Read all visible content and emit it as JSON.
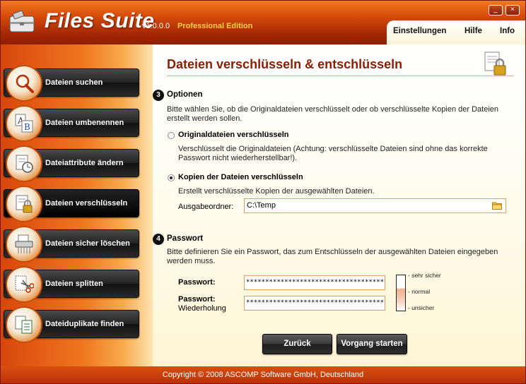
{
  "app": {
    "title": "Files Suite",
    "version": "v1.0.0.0",
    "edition": "Professional Edition"
  },
  "window_controls": {
    "minimize": "_",
    "close": "×"
  },
  "menu": {
    "items": [
      {
        "label": "Einstellungen"
      },
      {
        "label": "Hilfe"
      },
      {
        "label": "Info"
      }
    ]
  },
  "sidebar": {
    "items": [
      {
        "label": "Dateien suchen",
        "icon": "magnifier-icon",
        "active": false
      },
      {
        "label": "Dateien umbenennen",
        "icon": "rename-ab-icon",
        "active": false
      },
      {
        "label": "Dateiattribute ändern",
        "icon": "file-attribute-icon",
        "active": false
      },
      {
        "label": "Dateien verschlüsseln",
        "icon": "lock-document-icon",
        "active": true
      },
      {
        "label": "Dateien sicher löschen",
        "icon": "shredder-icon",
        "active": false
      },
      {
        "label": "Dateien splitten",
        "icon": "scissors-document-icon",
        "active": false
      },
      {
        "label": "Dateiduplikate finden",
        "icon": "duplicate-documents-icon",
        "active": false
      }
    ]
  },
  "main": {
    "title": "Dateien verschlüsseln & entschlüsseln",
    "options": {
      "step": "3",
      "title": "Optionen",
      "description": "Bitte wählen Sie, ob die Originaldateien verschlüsselt oder ob verschlüsselte Kopien der Dateien erstellt werden sollen.",
      "radio_original": {
        "label": "Originaldateien verschlüsseln",
        "description": "Verschlüsselt die Originaldateien (Achtung: verschlüsselte Dateien sind ohne das korrekte Passwort nicht wiederherstellbar!).",
        "selected": false
      },
      "radio_copies": {
        "label": "Kopien der Dateien verschlüsseln",
        "description": "Erstellt verschlüsselte Kopien der ausgewählten Dateien.",
        "selected": true
      },
      "output_folder_label": "Ausgabeordner:",
      "output_folder_value": "C:\\Temp"
    },
    "password": {
      "step": "4",
      "title": "Passwort",
      "description": "Bitte definieren Sie ein Passwort, das zum Entschlüsseln der ausgewählten Dateien eingegeben werden muss.",
      "password_label": "Passwort:",
      "password_value": "******************************************",
      "repeat_label": "Passwort:",
      "repeat_sublabel": "Wiederholung",
      "repeat_value": "******************************************",
      "strength": {
        "high": "- sehr sicher",
        "mid": "- normal",
        "low": "- unsicher"
      }
    },
    "buttons": {
      "back": "Zurück",
      "start": "Vorgang starten"
    }
  },
  "footer": {
    "copyright": "Copyright © 2008 ASCOMP Software GmbH, Deutschland"
  },
  "colors": {
    "accent": "#d74c0a",
    "title": "#8a1e05",
    "edition": "#ffd23f"
  }
}
